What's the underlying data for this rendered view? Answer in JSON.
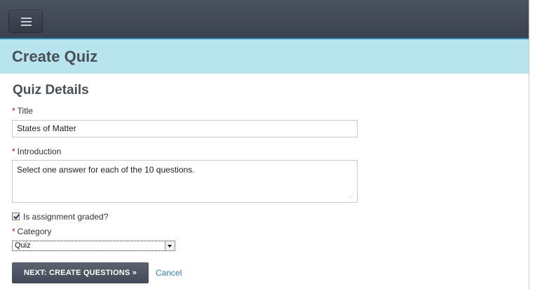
{
  "nav": {
    "menu_icon": "hamburger-menu-icon"
  },
  "header": {
    "title": "Create Quiz"
  },
  "form": {
    "section_title": "Quiz Details",
    "required_marker": "*",
    "title_label": "Title",
    "title_value": "States of Matter",
    "introduction_label": "Introduction",
    "introduction_value": "Select one answer for each of the 10 questions.",
    "graded_label": "Is assignment graded?",
    "graded_checked": true,
    "category_label": "Category",
    "category_value": "Quiz",
    "next_button_label": "NEXT: CREATE QUESTIONS »",
    "cancel_label": "Cancel"
  },
  "colors": {
    "topbar": "#3f4753",
    "header_band": "#b8e4ee",
    "required": "#d01010",
    "link": "#2a7fc1",
    "primary_button": "#4d5563"
  }
}
